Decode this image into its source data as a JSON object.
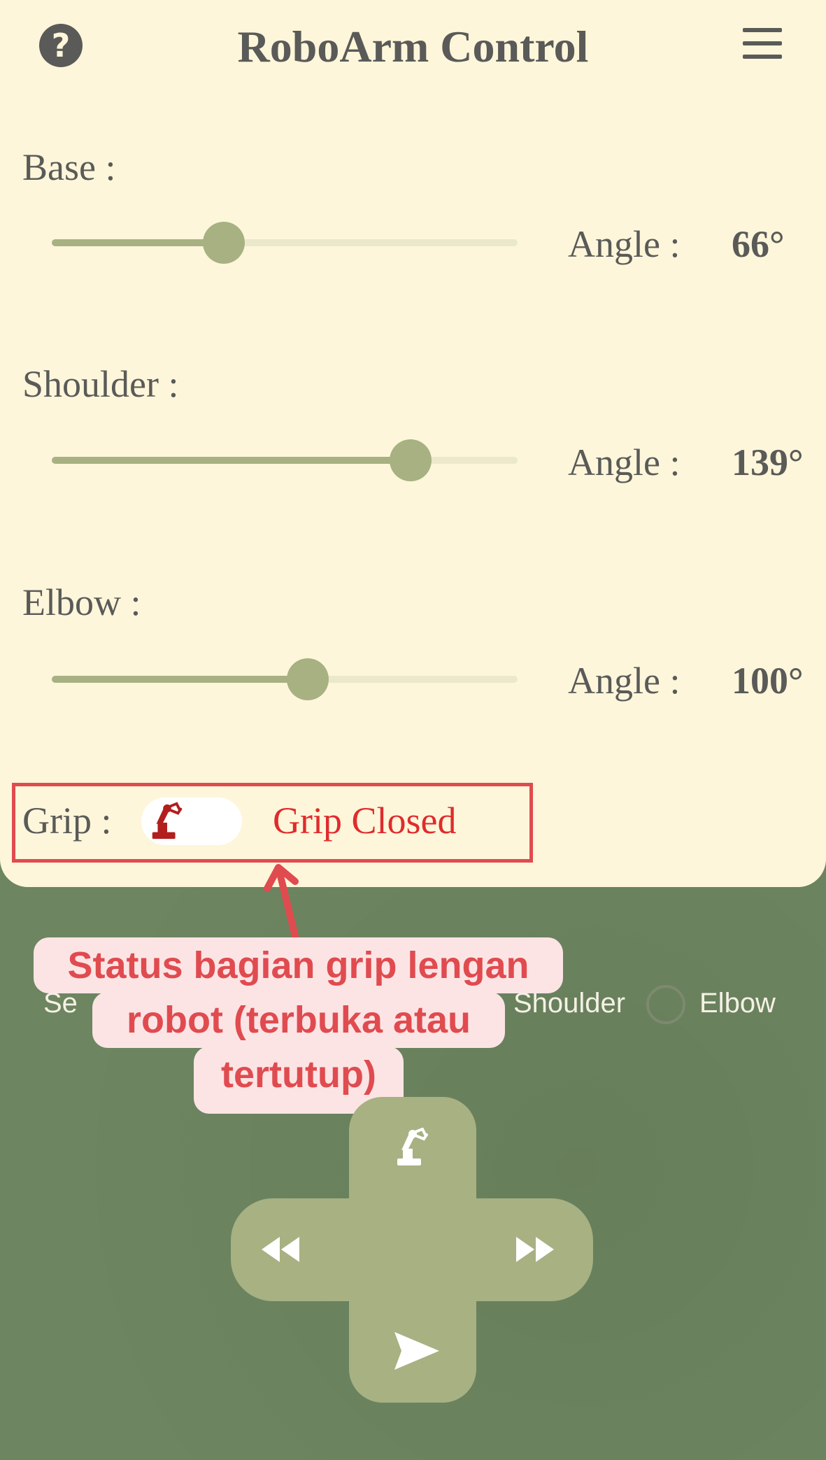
{
  "app": {
    "title": "RoboArm Control",
    "help_icon": "question-circle-icon",
    "menu_icon": "hamburger-menu-icon"
  },
  "joints": [
    {
      "label": "Base  :",
      "angle_label": "Angle  :",
      "angle_value": "66°",
      "slider_fraction": 0.37
    },
    {
      "label": "Shoulder  :",
      "angle_label": "Angle  :",
      "angle_value": "139°",
      "slider_fraction": 0.77
    },
    {
      "label": "Elbow  :",
      "angle_label": "Angle  :",
      "angle_value": "100°",
      "slider_fraction": 0.55
    }
  ],
  "grip": {
    "label": "Grip  :",
    "toggle_icon": "robot-arm-icon",
    "status": "Grip Closed"
  },
  "radio_row": {
    "left_partial": "Se",
    "shoulder": "Shoulder",
    "elbow": "Elbow"
  },
  "annotation": {
    "line1": "Status bagian grip lengan",
    "line2": "robot (terbuka atau",
    "line3": "tertutup)"
  },
  "dpad": {
    "up_icon": "robot-arm-icon",
    "left_icon": "rewind-icon",
    "right_icon": "fast-forward-icon",
    "down_icon": "send-icon"
  },
  "colors": {
    "panel_bg": "#fdf6da",
    "page_bg": "#6d8560",
    "accent": "#a7b182",
    "text": "#5a5a58",
    "annotation_red": "#e04b4f",
    "grip_status_red": "#e02b2d"
  }
}
